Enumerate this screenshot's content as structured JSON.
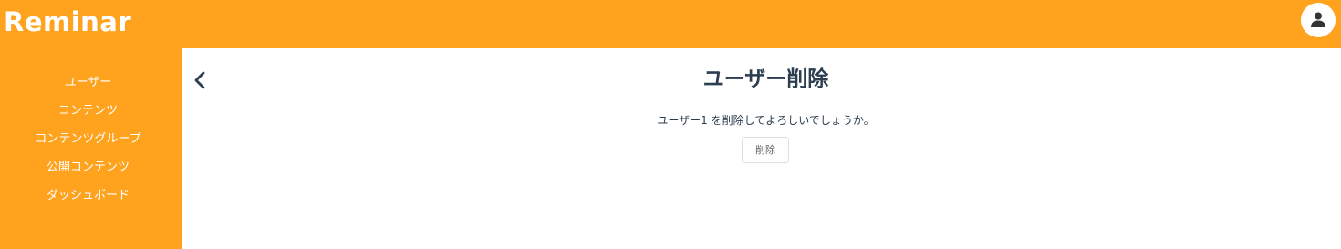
{
  "header": {
    "app_title": "Reminar",
    "avatar_icon": "user-icon"
  },
  "sidebar": {
    "items": [
      {
        "label": "ユーザー"
      },
      {
        "label": "コンテンツ"
      },
      {
        "label": "コンテンツグループ"
      },
      {
        "label": "公開コンテンツ"
      },
      {
        "label": "ダッシュボード"
      }
    ]
  },
  "main": {
    "back_icon": "chevron-left-icon",
    "title": "ユーザー削除",
    "confirm_message": "ユーザー1 を削除してよろしいでしょうか。",
    "delete_label": "削除"
  },
  "colors": {
    "brand": "#ffa31f",
    "title_text": "#2c3e50"
  }
}
